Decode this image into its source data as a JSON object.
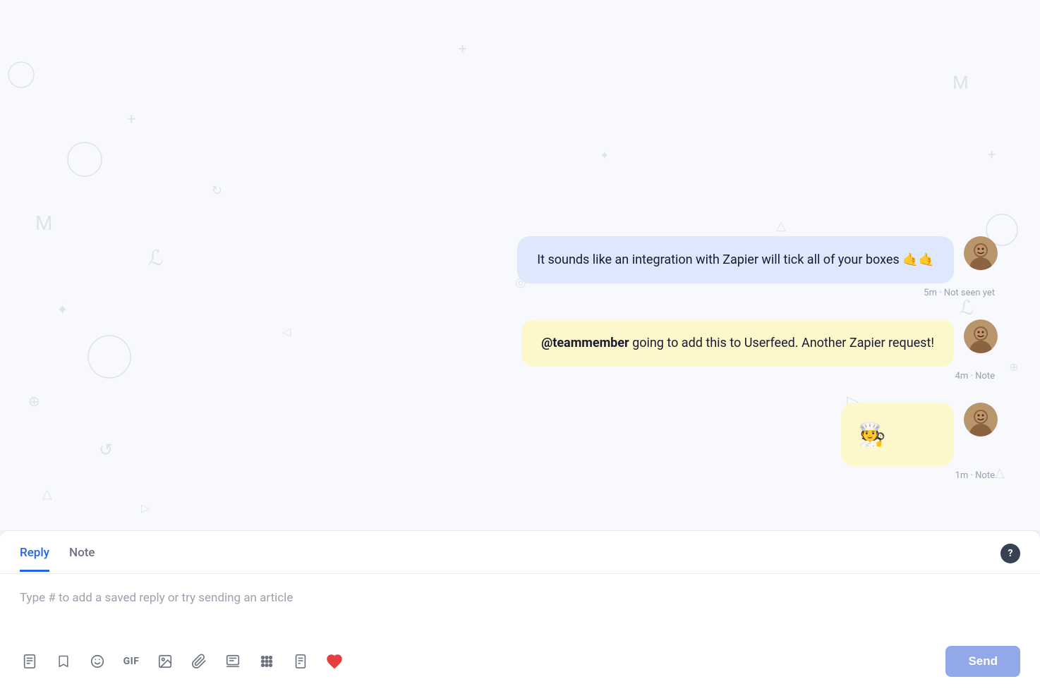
{
  "chat": {
    "messages": [
      {
        "id": "msg1",
        "text": "It sounds like an integration with Zapier will tick all of your boxes 🤙🤙",
        "type": "outgoing",
        "bubble_style": "blue-tint",
        "meta": "5m · Not seen yet",
        "has_avatar": true
      },
      {
        "id": "msg2",
        "text_parts": [
          {
            "bold": true,
            "text": "@teammember"
          },
          {
            "bold": false,
            "text": " going to add this to Userfeed. Another Zapier request!"
          }
        ],
        "type": "outgoing",
        "bubble_style": "yellow-tint",
        "meta": "4m · Note",
        "has_avatar": true
      },
      {
        "id": "msg3",
        "emoji": "🧑‍🍳",
        "type": "outgoing",
        "bubble_style": "yellow-small",
        "meta": "1m · Note",
        "has_avatar": true
      }
    ]
  },
  "reply_box": {
    "tabs": [
      {
        "id": "reply",
        "label": "Reply",
        "active": true
      },
      {
        "id": "note",
        "label": "Note",
        "active": false
      }
    ],
    "placeholder": "Type # to add a saved reply or try sending an article",
    "send_label": "Send",
    "help_label": "?"
  },
  "toolbar": {
    "icons": [
      {
        "name": "document-icon",
        "symbol": "☰",
        "label": "Document"
      },
      {
        "name": "bookmark-icon",
        "symbol": "🔖",
        "label": "Bookmark"
      },
      {
        "name": "emoji-icon",
        "symbol": "😊",
        "label": "Emoji"
      },
      {
        "name": "gif-icon",
        "symbol": "GIF",
        "label": "GIF",
        "type": "text"
      },
      {
        "name": "image-icon",
        "symbol": "🖼",
        "label": "Image"
      },
      {
        "name": "paperclip-icon",
        "symbol": "📎",
        "label": "Attachment"
      },
      {
        "name": "signature-icon",
        "symbol": "📋",
        "label": "Signature"
      },
      {
        "name": "apps-icon",
        "symbol": "⠿",
        "label": "Apps"
      },
      {
        "name": "article-icon",
        "symbol": "📄",
        "label": "Article"
      },
      {
        "name": "heart-icon",
        "symbol": "❤",
        "label": "Heart",
        "accent": true
      }
    ]
  }
}
